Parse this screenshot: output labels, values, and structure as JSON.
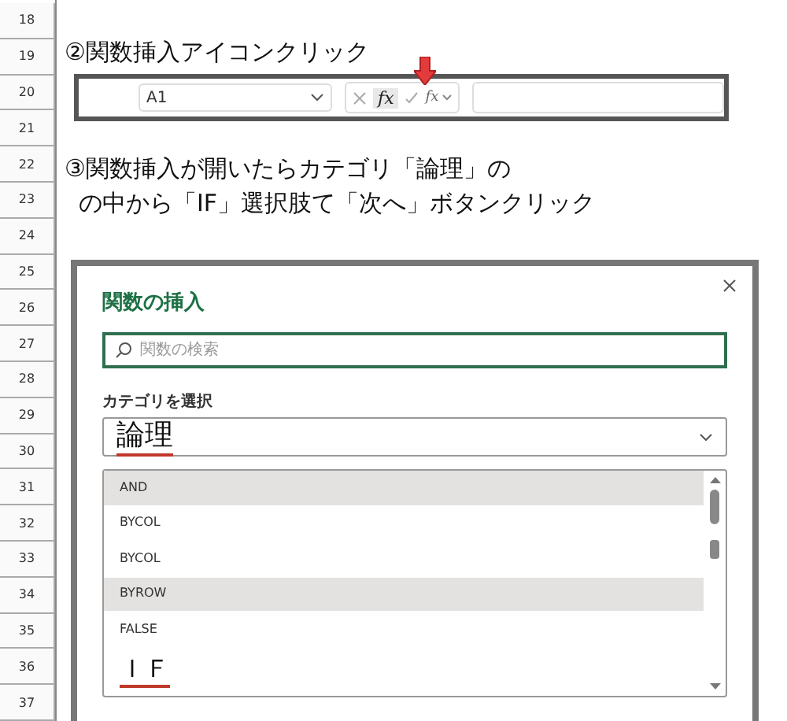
{
  "row_headers": [
    "18",
    "19",
    "20",
    "21",
    "22",
    "23",
    "24",
    "25",
    "26",
    "27",
    "28",
    "29",
    "30",
    "31",
    "32",
    "33",
    "34",
    "35",
    "36",
    "37"
  ],
  "step2": {
    "text": "②関数挿入アイコンクリック"
  },
  "formula_bar": {
    "name_box": "A1",
    "insert_function": "fx",
    "function_menu": "fx"
  },
  "step3": {
    "lines": [
      "③関数挿入が開いたらカテゴリ「論理」の",
      "の中から「IF」選択肢て「次へ」ボタンクリック"
    ]
  },
  "dialog": {
    "title": "関数の挿入",
    "search": {
      "placeholder": "関数の検索"
    },
    "category_label": "カテゴリを選択",
    "category": {
      "value": "論理",
      "underlined": true
    },
    "functions": [
      {
        "name": "AND",
        "highlighted": true,
        "underlined": false
      },
      {
        "name": "BYCOL",
        "highlighted": false,
        "underlined": false
      },
      {
        "name": "BYCOL",
        "highlighted": false,
        "underlined": false
      },
      {
        "name": "BYROW",
        "highlighted": true,
        "underlined": false
      },
      {
        "name": "FALSE",
        "highlighted": false,
        "underlined": false
      },
      {
        "name": "ＩＦ",
        "highlighted": false,
        "underlined": true
      }
    ]
  }
}
